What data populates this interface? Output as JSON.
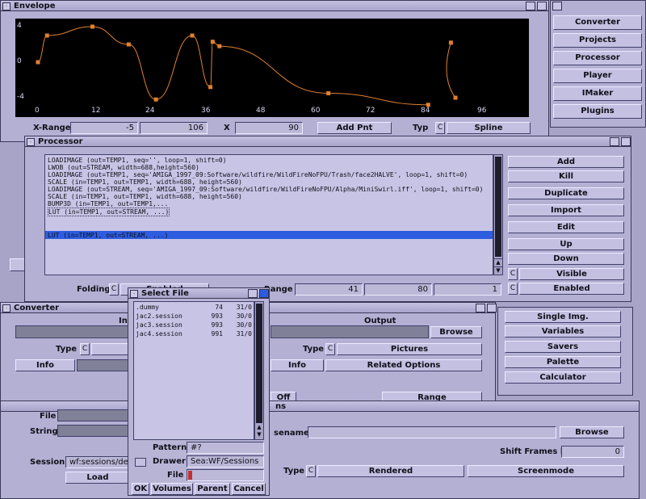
{
  "envelope": {
    "title": "Envelope",
    "y_ticks": [
      "4",
      "0",
      "-4"
    ],
    "x_ticks": [
      "0",
      "12",
      "24",
      "36",
      "48",
      "60",
      "72",
      "84",
      "96"
    ],
    "xrange_label": "X-Range",
    "xrange_min": "-5",
    "xrange_max": "106",
    "x_label": "X",
    "x_value": "90",
    "add_point_label": "Add Pnt",
    "type_label": "Typ",
    "type_value": "Spline",
    "curve_color": "#e08030",
    "bg_color": "#000000"
  },
  "menu": {
    "items": [
      "Converter",
      "Projects",
      "Processor",
      "Player",
      "IMaker",
      "Plugins"
    ]
  },
  "processor": {
    "title": "Processor",
    "lines": [
      "LOADIMAGE (out=TEMP1, seq='', loop=1, shift=0)",
      "LWOB (out=STREAM, width=688,height=560)",
      "LOADIMAGE (out=TEMP1, seq='AMIGA_1997_09:Software/wildfire/WildFireNoFPU/Trash/face2HALVE', loop=1, shift=0)",
      "SCALE (in=TEMP1, out=TEMP1, width=688, height=560)",
      "LOADIMAGE (out=STREAM, seq='AMIGA_1997_09:Software/wildfire/WildFireNoFPU/Alpha/MiniSwirl.iff', loop=1, shift=0)",
      "SCALE (in=TEMP1, out=TEMP1, width=688, height=560)",
      "BUMP3D (in=TEMP1, out=TEMP1,...",
      "LUT (in=TEMP1, out=STREAM, ...)",
      "LUT (in=TEMP1, out=STREAM, ...)"
    ],
    "buttons": [
      "Add",
      "Kill",
      "Duplicate",
      "Import",
      "Edit",
      "Up",
      "Down"
    ],
    "visible_label": "Visible",
    "enabled_label": "Enabled",
    "folding_label": "Folding",
    "folding_value": "Enabled",
    "range_label": "Range",
    "range_from": "41",
    "range_to": "80",
    "range_step": "1",
    "highlight_color": "#2c5ce0"
  },
  "converter": {
    "title": "Converter",
    "input_label": "In",
    "output_label": "Output",
    "browse_label": "Browse",
    "type_label": "Type",
    "output_type_value": "Pictures",
    "info_label": "Info",
    "related_options_label": "Related Options",
    "off_label": "Off",
    "range_label": "Range",
    "side_buttons": [
      "Single Img.",
      "Variables",
      "Savers",
      "Palette",
      "Calculator"
    ]
  },
  "lower": {
    "title_tail": "ns",
    "file_label": "File",
    "string_label": "String",
    "session_label": "Session",
    "session_value": "wf:sessions/de",
    "load_label": "Load",
    "basename_label": "sename",
    "browse_label": "Browse",
    "shift_frames_label": "Shift Frames by",
    "shift_frames_value": "0",
    "type_label": "Type",
    "type_value": "Rendered",
    "screenmode_label": "Screenmode"
  },
  "select_file": {
    "title": "Select File",
    "files": [
      {
        "name": ".dummy",
        "size": "74",
        "date": "31/0"
      },
      {
        "name": "jac2.session",
        "size": "993",
        "date": "30/0"
      },
      {
        "name": "jac3.session",
        "size": "993",
        "date": "30/0"
      },
      {
        "name": "jac4.session",
        "size": "991",
        "date": "31/0"
      }
    ],
    "pattern_label": "Pattern",
    "pattern_value": "#?",
    "drawer_label": "Drawer",
    "drawer_value": "Sea:WF/Sessions",
    "file_label": "File",
    "file_value": "",
    "ok_label": "OK",
    "volumes_label": "Volumes",
    "parent_label": "Parent",
    "cancel_label": "Cancel"
  }
}
